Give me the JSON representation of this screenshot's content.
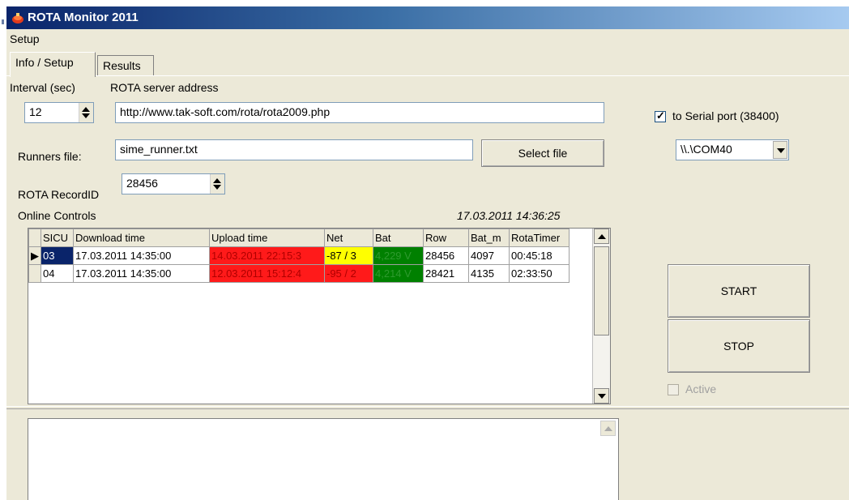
{
  "window": {
    "title": "ROTA Monitor 2011"
  },
  "menu": {
    "setup": "Setup"
  },
  "tabs": {
    "info": "Info / Setup",
    "results": "Results"
  },
  "form": {
    "interval_label": "Interval (sec)",
    "interval_value": "12",
    "server_label": "ROTA server address",
    "server_value": "http://www.tak-soft.com/rota/rota2009.php",
    "runners_label": "Runners file:",
    "runners_value": "sime_runner.txt",
    "select_file": "Select file",
    "recordid_label": "ROTA RecordID",
    "recordid_value": "28456",
    "online_label": "Online Controls",
    "timestamp": "17.03.2011 14:36:25"
  },
  "serial": {
    "checkbox_label": "to Serial port (38400)",
    "checked": true,
    "port": "\\\\.\\COM40"
  },
  "buttons": {
    "start": "START",
    "stop": "STOP",
    "active": "Active"
  },
  "grid": {
    "columns": [
      "SICU",
      "Download time",
      "Upload time",
      "Net",
      "Bat",
      "Row",
      "Bat_m",
      "RotaTimer"
    ],
    "rows": [
      {
        "sicu": "03",
        "download": "17.03.2011 14:35:00",
        "upload": "14.03.2011 22:15:3",
        "net": "-87 / 3",
        "bat": "4,229 V",
        "row": "28456",
        "bat_m": "4097",
        "timer": "00:45:18"
      },
      {
        "sicu": "04",
        "download": "17.03.2011 14:35:00",
        "upload": "12.03.2011 15:12:4",
        "net": "-95 / 2",
        "bat": "4,214 V",
        "row": "28421",
        "bat_m": "4135",
        "timer": "02:33:50"
      }
    ]
  },
  "colors": {
    "status_bad": "#ff1a1a",
    "status_warn": "#ffff00",
    "status_ok": "#008000",
    "selection": "#0a246a"
  }
}
